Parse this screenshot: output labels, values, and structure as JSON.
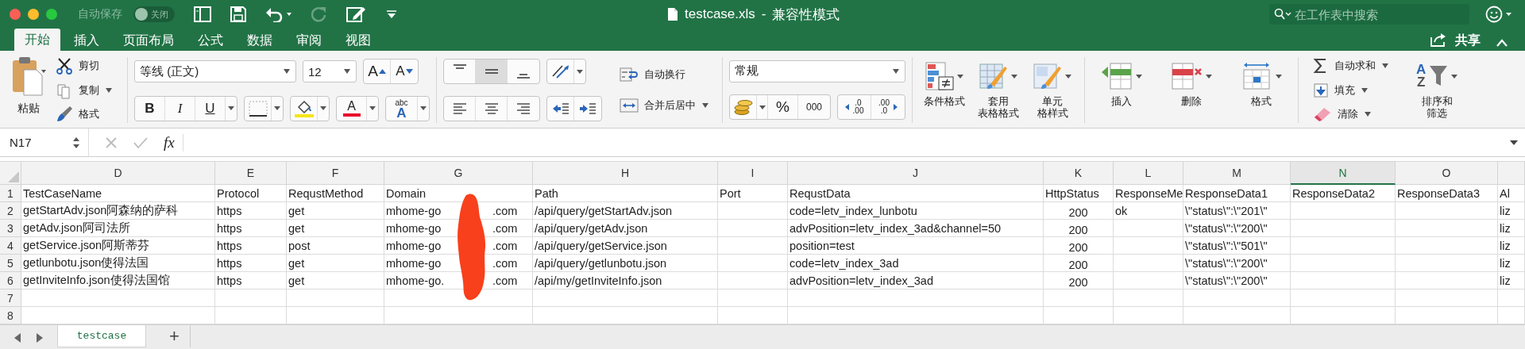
{
  "window": {
    "autosave_label": "自动保存",
    "autosave": {
      "on": false,
      "label": "关闭"
    },
    "title": "testcase.xls",
    "separator": "-",
    "mode": "兼容性模式",
    "search": {
      "placeholder": "在工作表中搜索"
    }
  },
  "tabs": [
    {
      "label": "开始",
      "selected": true
    },
    {
      "label": "插入",
      "selected": false
    },
    {
      "label": "页面布局",
      "selected": false
    },
    {
      "label": "公式",
      "selected": false
    },
    {
      "label": "数据",
      "selected": false
    },
    {
      "label": "审阅",
      "selected": false
    },
    {
      "label": "视图",
      "selected": false
    }
  ],
  "share": "共享",
  "ribbon": {
    "clipboard": {
      "paste": "粘贴",
      "cut": "剪切",
      "copy": "复制",
      "format": "格式"
    },
    "font": {
      "name": "等线 (正文)",
      "size": "12",
      "grow": "A",
      "shrink": "A",
      "bold": "B",
      "italic": "I",
      "underline": "U",
      "font_color": "A",
      "phonetic": [
        "abc",
        "A"
      ]
    },
    "alignment": {
      "vertical": [
        {
          "kind": "top",
          "selected": false
        },
        {
          "kind": "middle",
          "selected": true
        },
        {
          "kind": "bottom",
          "selected": false
        }
      ],
      "horizontal": [
        {
          "kind": "left",
          "selected": false
        },
        {
          "kind": "center",
          "selected": false
        },
        {
          "kind": "right",
          "selected": false
        }
      ],
      "wrap": "自动换行",
      "merge": "合并后居中"
    },
    "number": {
      "format": "常规",
      "percent": "%",
      "comma": "000",
      "decimal_increase": [
        ".0",
        ".00"
      ],
      "decimal_decrease": [
        ".00",
        ".0"
      ]
    },
    "styles": [
      {
        "kind": "conditional",
        "lines": [
          "条件格式"
        ]
      },
      {
        "kind": "table",
        "lines": [
          "套用",
          "表格格式"
        ]
      },
      {
        "kind": "cell",
        "lines": [
          "单元",
          "格样式"
        ]
      }
    ],
    "cells": [
      {
        "kind": "insert",
        "label": "插入"
      },
      {
        "kind": "delete",
        "label": "删除"
      },
      {
        "kind": "format",
        "label": "格式"
      }
    ],
    "editing": {
      "autosum": "自动求和",
      "fill": "填充",
      "clear": "清除",
      "sort": [
        "排序和",
        "筛选"
      ],
      "sort_icon": [
        "A",
        "Z"
      ]
    }
  },
  "formula_bar": {
    "name_box": "N17",
    "function_label": "fx"
  },
  "sheet": {
    "redaction": true,
    "columns": [
      {
        "letter": "D",
        "selected": false,
        "kind": "text"
      },
      {
        "letter": "E",
        "selected": false,
        "kind": "text"
      },
      {
        "letter": "F",
        "selected": false,
        "kind": "text"
      },
      {
        "letter": "G",
        "selected": false,
        "kind": "text"
      },
      {
        "letter": "H",
        "selected": false,
        "kind": "text"
      },
      {
        "letter": "I",
        "selected": false,
        "kind": "text"
      },
      {
        "letter": "J",
        "selected": false,
        "kind": "text"
      },
      {
        "letter": "K",
        "selected": false,
        "kind": "number"
      },
      {
        "letter": "L",
        "selected": false,
        "kind": "text"
      },
      {
        "letter": "M",
        "selected": false,
        "kind": "text"
      },
      {
        "letter": "N",
        "selected": true,
        "kind": "text"
      },
      {
        "letter": "O",
        "selected": false,
        "kind": "text"
      },
      {
        "selected": false,
        "kind": "text"
      }
    ],
    "rows": [
      {
        "number": "1",
        "kind": "header",
        "cells": [
          "TestCaseName",
          "Protocol",
          "RequstMethod",
          "Domain",
          "Path",
          "Port",
          "RequstData",
          "HttpStatus",
          "ResponseMe",
          "ResponseData1",
          "ResponseData2",
          "ResponseData3",
          "Al"
        ]
      },
      {
        "number": "2",
        "kind": "data",
        "cells": [
          "getStartAdv.json阿森纳的萨科",
          "https",
          "get",
          {
            "text": "mhome-go",
            "tail": ".com"
          },
          "/api/query/getStartAdv.json",
          null,
          "code=letv_index_lunbotu",
          "200",
          "ok",
          "\\\"status\\\":\\\"201\\\"",
          null,
          null,
          "liz"
        ]
      },
      {
        "number": "3",
        "kind": "data",
        "cells": [
          "getAdv.json阿司法所",
          "https",
          "get",
          {
            "text": "mhome-go",
            "tail": ".com"
          },
          "/api/query/getAdv.json",
          null,
          "advPosition=letv_index_3ad&channel=50",
          "200",
          null,
          "\\\"status\\\":\\\"200\\\"",
          null,
          null,
          "liz"
        ]
      },
      {
        "number": "4",
        "kind": "data",
        "cells": [
          "getService.json阿斯蒂芬",
          "https",
          "post",
          {
            "text": "mhome-go",
            "tail": ".com"
          },
          "/api/query/getService.json",
          null,
          "position=test",
          "200",
          null,
          "\\\"status\\\":\\\"501\\\"",
          null,
          null,
          "liz"
        ]
      },
      {
        "number": "5",
        "kind": "data",
        "cells": [
          "getlunbotu.json使得法国",
          "https",
          "get",
          {
            "text": "mhome-go",
            "tail": ".com"
          },
          "/api/query/getlunbotu.json",
          null,
          "code=letv_index_3ad",
          "200",
          null,
          "\\\"status\\\":\\\"200\\\"",
          null,
          null,
          "liz"
        ]
      },
      {
        "number": "6",
        "kind": "data",
        "cells": [
          "getInviteInfo.json使得法国馆",
          "https",
          "get",
          {
            "text": "mhome-go.",
            "tail": ".com"
          },
          "/api/my/getInviteInfo.json",
          null,
          "advPosition=letv_index_3ad",
          "200",
          null,
          "\\\"status\\\":\\\"200\\\"",
          null,
          null,
          "liz"
        ]
      },
      {
        "number": "7",
        "kind": "data"
      },
      {
        "number": "8",
        "kind": "data"
      }
    ]
  },
  "sheet_tabs": [
    {
      "label": "testcase",
      "selected": true
    }
  ],
  "add_sheet": "+"
}
